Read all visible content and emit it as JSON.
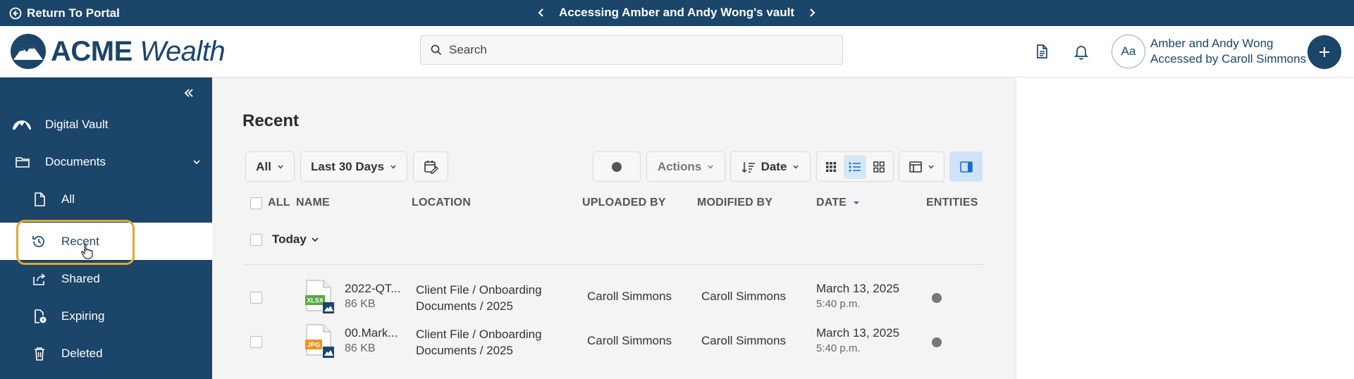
{
  "topbar": {
    "return_label": "Return To Portal",
    "vault_title": "Accessing Amber and Andy Wong's vault"
  },
  "header": {
    "logo_bold": "ACME",
    "logo_italic": "Wealth",
    "search_placeholder": "Search",
    "avatar_initials": "Aa",
    "user_name": "Amber and Andy Wong",
    "user_sub": "Accessed by Caroll Simmons"
  },
  "sidebar": {
    "items": [
      {
        "label": "Digital Vault"
      },
      {
        "label": "Documents"
      },
      {
        "label": "All"
      },
      {
        "label": "Recent"
      },
      {
        "label": "Shared"
      },
      {
        "label": "Expiring"
      },
      {
        "label": "Deleted"
      }
    ]
  },
  "main": {
    "title": "Recent",
    "filters": {
      "all": "All",
      "range": "Last 30 Days",
      "actions": "Actions",
      "sort": "Date"
    },
    "columns": {
      "all": "ALL",
      "name": "NAME",
      "location": "LOCATION",
      "uploaded_by": "UPLOADED BY",
      "modified_by": "MODIFIED BY",
      "date": "DATE",
      "entities": "ENTITIES"
    },
    "group_label": "Today",
    "rows": [
      {
        "name": "2022-QT...",
        "size": "86 KB",
        "type": "XLSX",
        "type_color": "#5aa845",
        "location_1": "Client File / Onboarding",
        "location_2": "Documents / 2025",
        "uploaded_by": "Caroll Simmons",
        "modified_by": "Caroll Simmons",
        "date": "March 13, 2025",
        "time": "5:40 p.m."
      },
      {
        "name": "00.Mark...",
        "size": "86 KB",
        "type": "JPG",
        "type_color": "#f0921c",
        "location_1": "Client File / Onboarding",
        "location_2": "Documents / 2025",
        "uploaded_by": "Caroll Simmons",
        "modified_by": "Caroll Simmons",
        "date": "March 13, 2025",
        "time": "5:40 p.m."
      }
    ]
  },
  "colors": {
    "brand": "#1b4569",
    "highlight": "#e3a92c",
    "active_toggle": "#cfe3f8"
  }
}
